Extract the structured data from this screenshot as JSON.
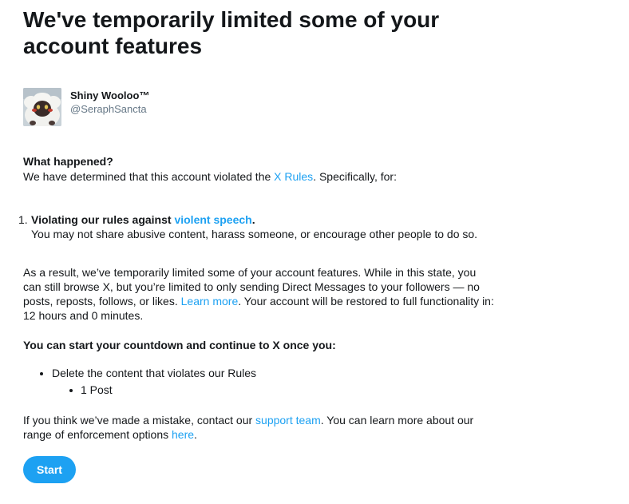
{
  "title_line1": "We've temporarily limited some of your",
  "title_line2": "account features",
  "user": {
    "display_name": "Shiny Wooloo™",
    "handle": "@SeraphSancta"
  },
  "what_happened": {
    "heading": "What happened?",
    "text_before": "We have determined that this account violated the ",
    "rules_link": "X Rules",
    "text_after": ". Specifically, for:"
  },
  "violation": {
    "number": "1.",
    "title_before": "Violating our rules against ",
    "title_link": "violent speech",
    "title_after": ".",
    "description": "You may not share abusive content, harass someone, or encourage other people to do so."
  },
  "result": {
    "line1": "As a result, we’ve temporarily limited some of your account features. While in this state, you",
    "line2": "can still browse X, but you’re limited to only sending Direct Messages to your followers — no",
    "line3_before": "posts, reposts, follows, or likes. ",
    "learn_more": "Learn more",
    "line3_after": ". Your account will be restored to full functionality in:",
    "line4": "12 hours and 0 minutes."
  },
  "countdown_heading": "You can start your countdown and continue to X once you:",
  "requirements": {
    "item": "Delete the content that violates our Rules",
    "subitem": "1 Post"
  },
  "mistake": {
    "line1_before": "If you think we’ve made a mistake, contact our ",
    "support_link": "support team",
    "line1_after": ". You can learn more about our",
    "line2_before": "range of enforcement options ",
    "here_link": "here",
    "line2_after": "."
  },
  "start_button": "Start",
  "colors": {
    "accent": "#1da1f2",
    "text": "#14171a",
    "secondary": "#657786"
  }
}
